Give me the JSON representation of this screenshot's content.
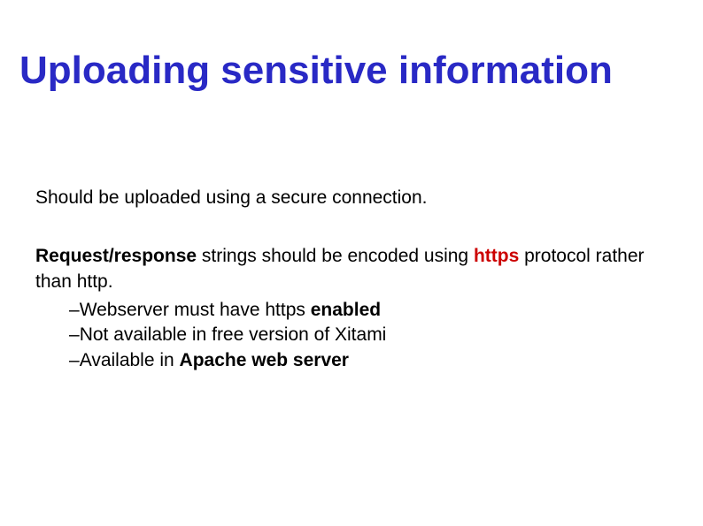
{
  "title": "Uploading sensitive information",
  "para1": "Should be uploaded using a secure connection.",
  "p2": {
    "lead_bold": "Request/response",
    "lead_rest": " strings should be encoded using ",
    "https": "https",
    "tail": " protocol rather than http."
  },
  "sub": {
    "a_pre": "Webserver must have https ",
    "a_bold": "enabled",
    "b": "Not available in free version of Xitami",
    "c_pre": "Available in ",
    "c_bold": "Apache web server"
  }
}
